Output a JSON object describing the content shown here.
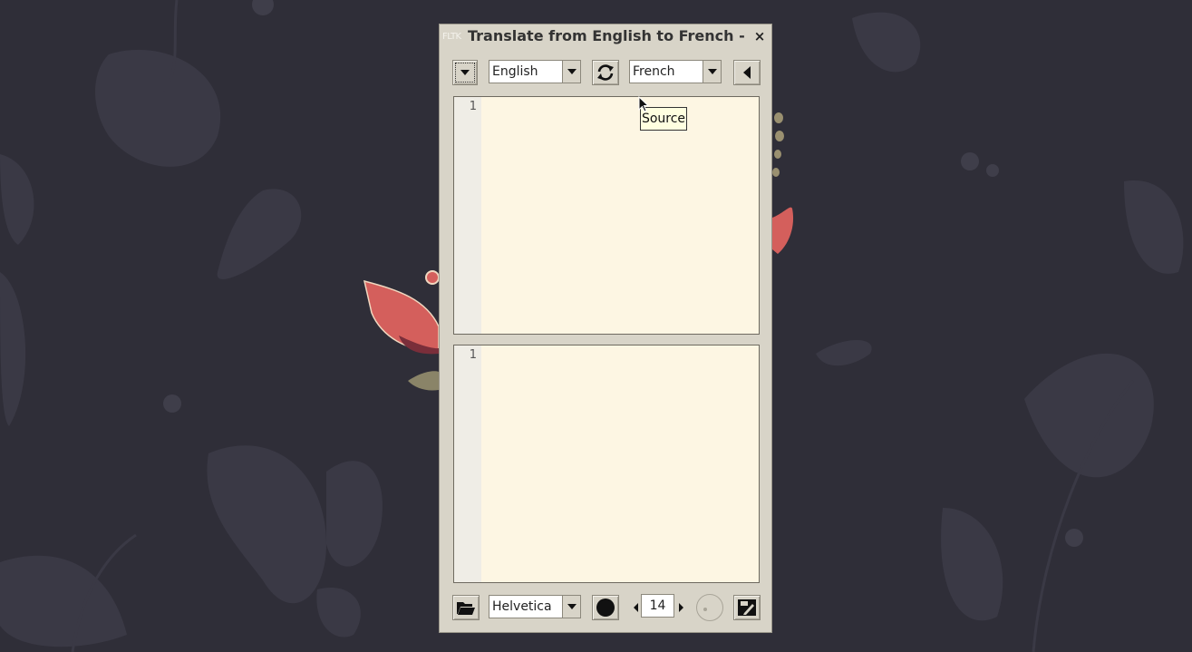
{
  "window": {
    "app_icon_text": "FLTK",
    "title": "Translate from English to French - F",
    "close_glyph": "×"
  },
  "toolbar": {
    "menu_icon": "chevron-down-icon",
    "source_language": "English",
    "swap_icon": "refresh-icon",
    "target_language": "French",
    "collapse_icon": "triangle-left-icon"
  },
  "source_editor": {
    "line_number": "1",
    "text": ""
  },
  "target_editor": {
    "line_number": "1",
    "text": ""
  },
  "tooltip": {
    "text": "Source"
  },
  "bottom_bar": {
    "open_icon": "folder-open-icon",
    "font": "Helvetica",
    "color_icon": "black-circle-icon",
    "font_size": "14",
    "radio_icon": "empty-circle-icon",
    "save_icon": "save-edit-icon"
  },
  "colors": {
    "desktop_bg": "#2f2e38",
    "window_bg": "#d8d4c8",
    "editor_bg": "#fdf6e3",
    "tooltip_bg": "#ffffe0"
  }
}
